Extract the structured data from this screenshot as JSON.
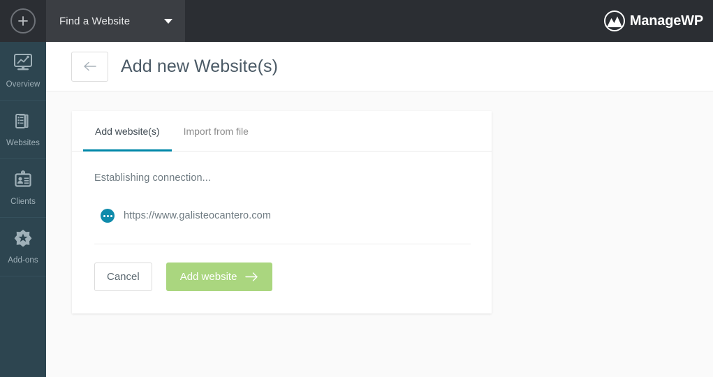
{
  "topbar": {
    "add_icon": "plus-circle-icon",
    "search_label": "Find a Website",
    "caret_icon": "chevron-down-icon",
    "brand": "ManageWP",
    "brand_icon": "managewp-logo-icon"
  },
  "sidebar": {
    "items": [
      {
        "label": "Overview",
        "icon": "monitor-chart-icon"
      },
      {
        "label": "Websites",
        "icon": "stacked-pages-icon"
      },
      {
        "label": "Clients",
        "icon": "id-card-icon"
      },
      {
        "label": "Add-ons",
        "icon": "star-burst-icon"
      }
    ]
  },
  "header": {
    "back_icon": "arrow-left-icon",
    "title": "Add new Website(s)"
  },
  "card": {
    "tabs": [
      {
        "label": "Add website(s)",
        "active": true
      },
      {
        "label": "Import from file",
        "active": false
      }
    ],
    "status_text": "Establishing connection...",
    "site": {
      "badge_icon": "loading-dots-icon",
      "url": "https://www.galisteocantero.com"
    },
    "buttons": {
      "cancel": "Cancel",
      "add": "Add website",
      "add_icon": "arrow-right-icon"
    }
  },
  "colors": {
    "topbar": "#2b2e33",
    "topbar_search": "#3b3e43",
    "sidebar": "#2d4550",
    "accent_tab": "#0087a8",
    "badge": "#0f8bab",
    "button_green": "#aad67f",
    "page_bg": "#fafafa"
  }
}
